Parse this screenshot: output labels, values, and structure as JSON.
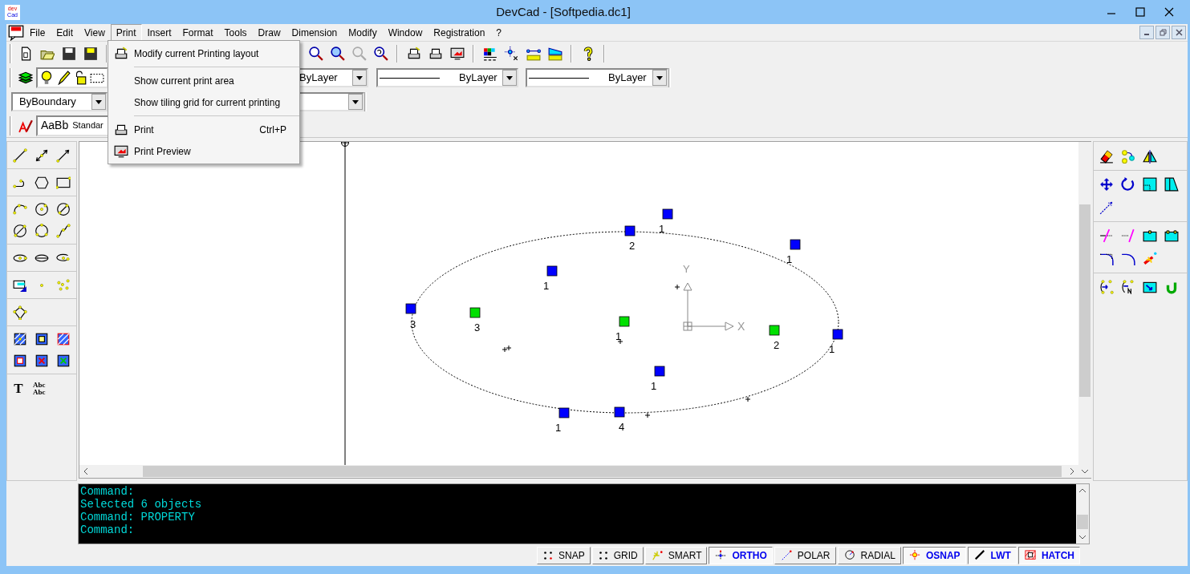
{
  "window": {
    "title": "DevCad - [Softpedia.dc1]",
    "logo": [
      "dev",
      "Cad"
    ]
  },
  "menubar": [
    {
      "label": "File",
      "selected": false
    },
    {
      "label": "Edit",
      "selected": false
    },
    {
      "label": "View",
      "selected": false
    },
    {
      "label": "Print",
      "selected": true
    },
    {
      "label": "Insert",
      "selected": false
    },
    {
      "label": "Format",
      "selected": false
    },
    {
      "label": "Tools",
      "selected": false
    },
    {
      "label": "Draw",
      "selected": false
    },
    {
      "label": "Dimension",
      "selected": false
    },
    {
      "label": "Modify",
      "selected": false
    },
    {
      "label": "Window",
      "selected": false
    },
    {
      "label": "Registration",
      "selected": false
    },
    {
      "label": "?",
      "selected": false
    }
  ],
  "print_menu": {
    "items": [
      {
        "kind": "item",
        "label": "Modify current Printing layout"
      },
      {
        "kind": "separator"
      },
      {
        "kind": "item",
        "label": "Show current print area"
      },
      {
        "kind": "item",
        "label": "Show tiling grid for current printing"
      },
      {
        "kind": "separator"
      },
      {
        "kind": "item",
        "label": "Print",
        "shortcut": "Ctrl+P"
      },
      {
        "kind": "item",
        "label": "Print Preview"
      }
    ]
  },
  "property_toolbar": {
    "color_setting": "ByLayer",
    "linetype": "ByLayer",
    "lineweight": "ByLayer"
  },
  "hatch_toolbar": {
    "pattern": "ByBoundary"
  },
  "text_style_toolbar": {
    "sample": "AaBb",
    "style": "Standar"
  },
  "draw_toolbar": {
    "text_glyph": "T",
    "mtext_glyphs": [
      "Abc",
      "Abc"
    ]
  },
  "canvas": {
    "ucs": {
      "x": "X",
      "y": "Y"
    },
    "grips": [
      {
        "label": "1",
        "color": "#0000ff"
      },
      {
        "label": "2",
        "color": "#0000ff"
      },
      {
        "label": "1",
        "color": "#0000ff"
      },
      {
        "label": "1",
        "color": "#0000ff"
      },
      {
        "label": "3",
        "color": "#0000ff"
      },
      {
        "label": "3",
        "color": "#00e000"
      },
      {
        "label": "1",
        "color": "#00e000"
      },
      {
        "label": "2",
        "color": "#00e000"
      },
      {
        "label": "1",
        "color": "#0000ff"
      },
      {
        "label": "1",
        "color": "#0000ff"
      },
      {
        "label": "1",
        "color": "#0000ff"
      },
      {
        "label": "4",
        "color": "#0000ff"
      }
    ]
  },
  "command_lines": [
    "Command:",
    "Selected 6 objects",
    "Command: PROPERTY",
    "Command:"
  ],
  "status_bar": {
    "toggles": [
      {
        "label": "SNAP",
        "on": false
      },
      {
        "label": "GRID",
        "on": false
      },
      {
        "label": "SMART",
        "on": false
      },
      {
        "label": "ORTHO",
        "on": true
      },
      {
        "label": "POLAR",
        "on": false
      },
      {
        "label": "RADIAL",
        "on": false
      },
      {
        "label": "OSNAP",
        "on": true
      },
      {
        "label": "LWT",
        "on": true
      },
      {
        "label": "HATCH",
        "on": true
      }
    ]
  }
}
